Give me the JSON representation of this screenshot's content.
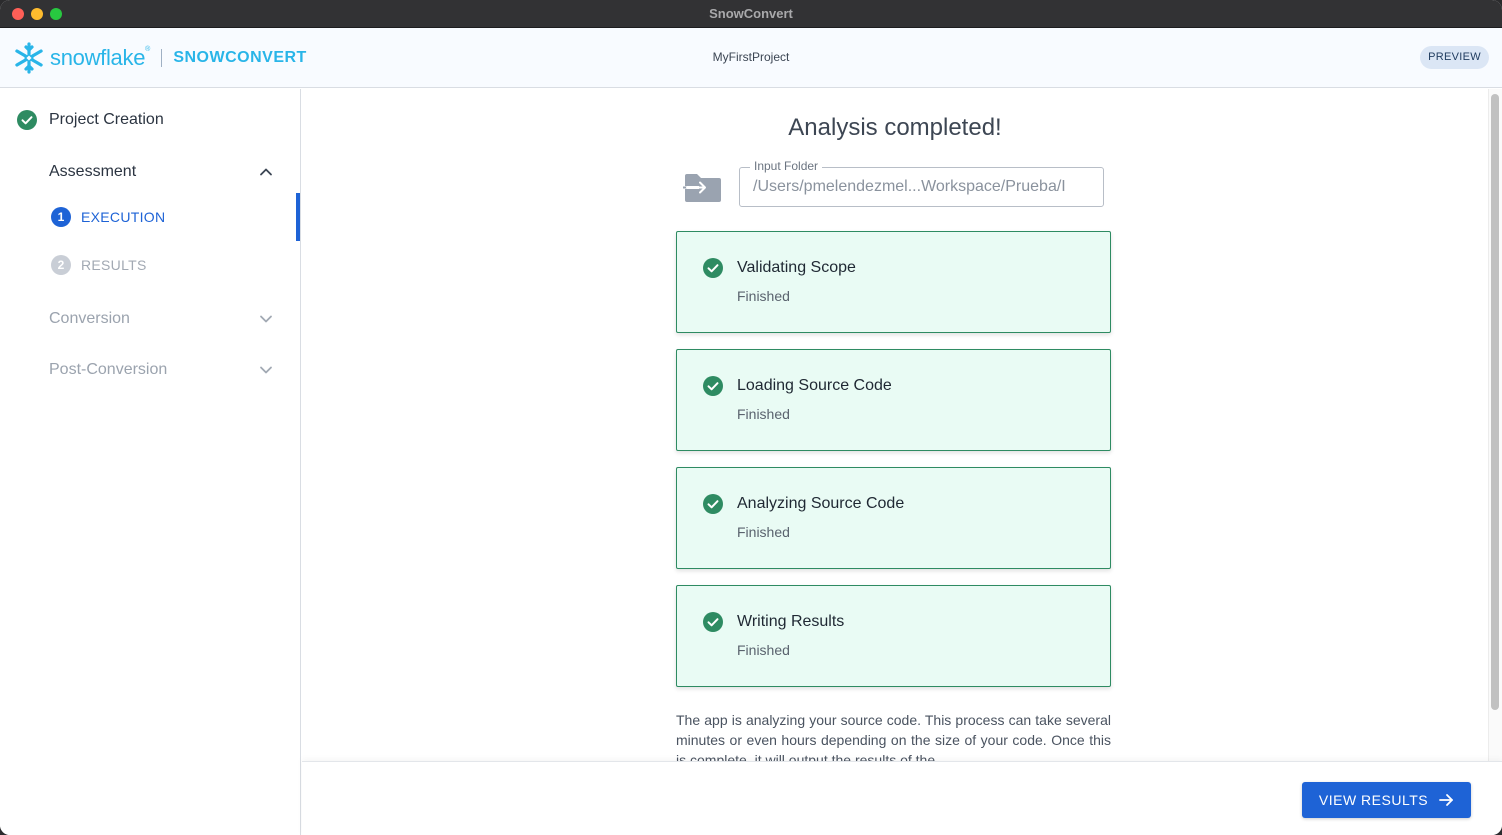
{
  "window": {
    "title": "SnowConvert"
  },
  "header": {
    "logo_brand": "snowflake",
    "logo_product": "SNOWCONVERT",
    "project_name": "MyFirstProject",
    "badge": "PREVIEW"
  },
  "sidebar": {
    "project_creation": "Project Creation",
    "assessment": {
      "label": "Assessment",
      "steps": [
        {
          "number": "1",
          "label": "EXECUTION",
          "state": "active"
        },
        {
          "number": "2",
          "label": "RESULTS",
          "state": "disabled"
        }
      ]
    },
    "conversion": "Conversion",
    "post_conversion": "Post-Conversion"
  },
  "main": {
    "title": "Analysis completed!",
    "input_folder": {
      "label": "Input Folder",
      "value": "/Users/pmelendezmel...Workspace/Prueba/I"
    },
    "tasks": [
      {
        "title": "Validating Scope",
        "status": "Finished"
      },
      {
        "title": "Loading Source Code",
        "status": "Finished"
      },
      {
        "title": "Analyzing Source Code",
        "status": "Finished"
      },
      {
        "title": "Writing Results",
        "status": "Finished"
      }
    ],
    "description": "The app is analyzing your source code. This process can take several minutes or even hours depending on the size of your code. Once this is complete, it will output the results of the"
  },
  "footer": {
    "view_results_label": "VIEW RESULTS"
  },
  "colors": {
    "accent_blue": "#1e63d6",
    "success_green": "#2e8b62",
    "card_background": "#e9fbf4",
    "brand_cyan": "#29b5e8"
  },
  "icons": {
    "logo": "snowflake-icon",
    "check": "check-circle-icon",
    "chevron_up": "chevron-up-icon",
    "chevron_down": "chevron-down-icon",
    "folder": "folder-input-icon",
    "arrow": "arrow-right-icon"
  }
}
